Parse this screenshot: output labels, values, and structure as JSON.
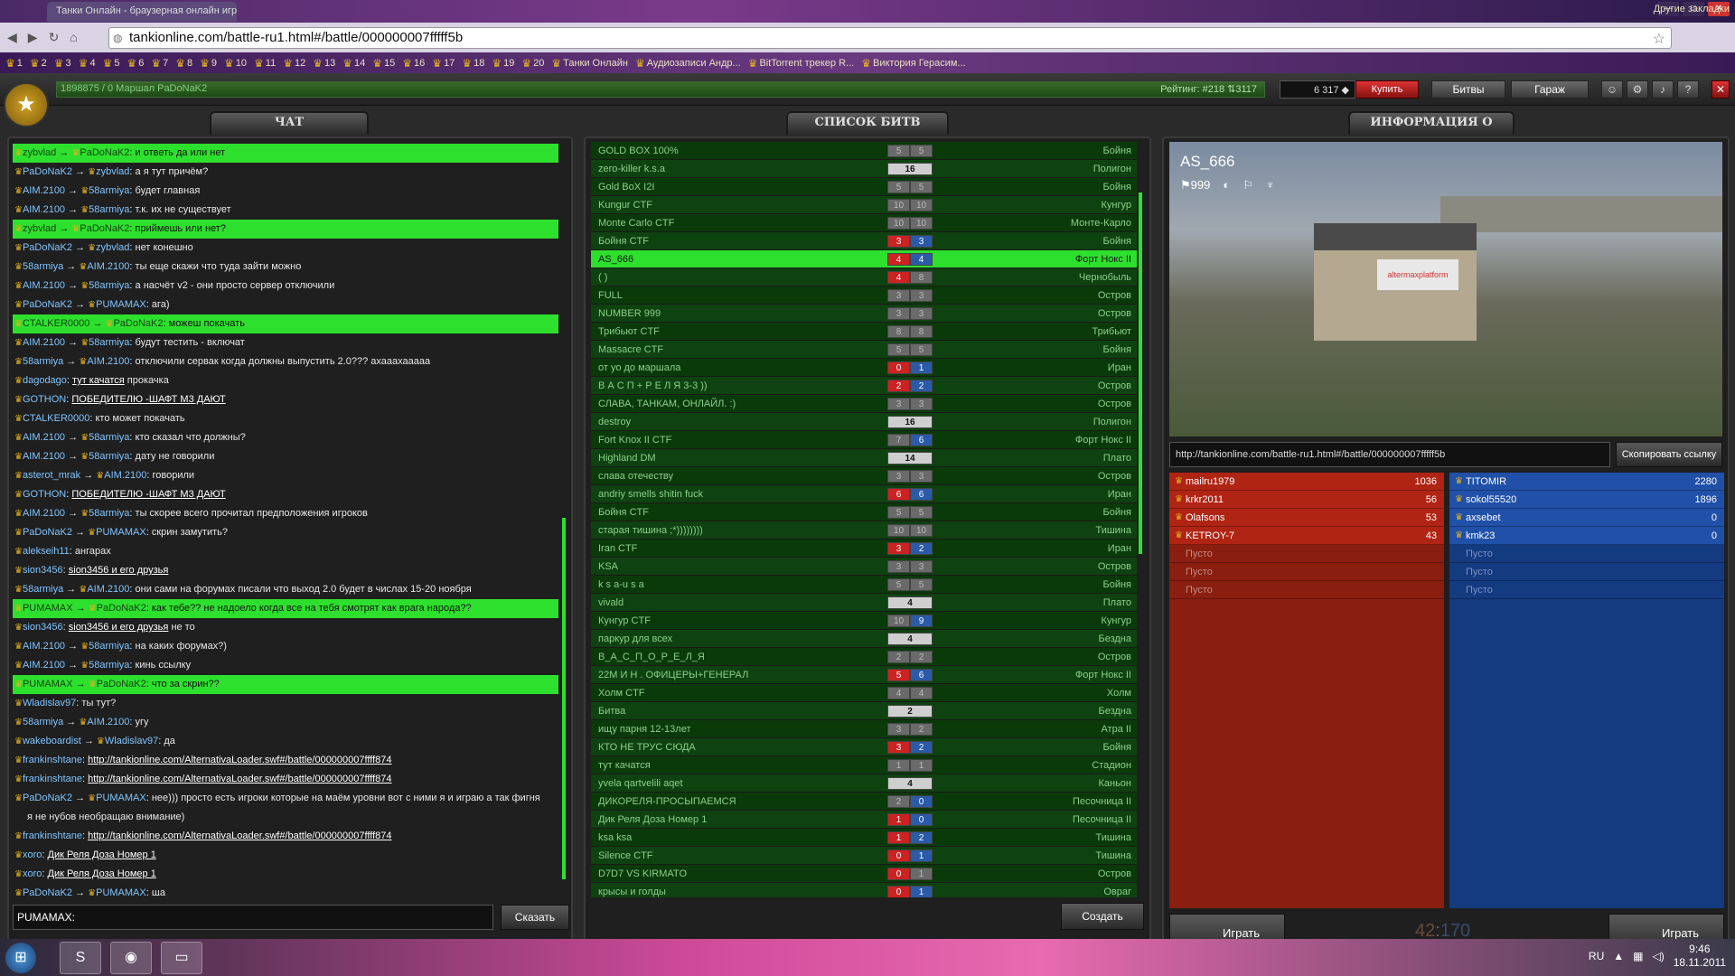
{
  "browser": {
    "tab_title": "Танки Онлайн - браузерная онлайн игра",
    "url": "tankionline.com/battle-ru1.html#/battle/000000007fffff5b",
    "bookmarks": [
      "1",
      "2",
      "3",
      "4",
      "5",
      "6",
      "7",
      "8",
      "9",
      "10",
      "11",
      "12",
      "13",
      "14",
      "15",
      "16",
      "17",
      "18",
      "19",
      "20",
      "Танки Онлайн",
      "Аудиозаписи Андр...",
      "BitTorrent трекер R...",
      "Виктория Герасим..."
    ],
    "other_bookmarks": "Другие закладки"
  },
  "topbar": {
    "xp_text": "1898875 / 0  Маршал PaDoNaK2",
    "rating": "Рейтинг: #218  ⇅3117",
    "crystals": "6 317 ◆",
    "buy_label": "Купить",
    "battles_label": "Битвы",
    "garage_label": "Гараж",
    "help_label": "?",
    "exit_label": "✕"
  },
  "titles": {
    "chat": "ЧАТ",
    "battles": "СПИСОК БИТВ",
    "info": "ИНФОРМАЦИЯ О БИТВЕ"
  },
  "chat": {
    "messages": [
      {
        "from": "zybvlad",
        "to": "PaDoNaK2",
        "text": "и ответь да или нет",
        "hl": true
      },
      {
        "from": "PaDoNaK2",
        "to": "zybvlad",
        "text": "а я тут причём?"
      },
      {
        "from": "AIM.2100",
        "to": "58armiya",
        "text": "будет главная"
      },
      {
        "from": "AIM.2100",
        "to": "58armiya",
        "text": "т.к. их не существует"
      },
      {
        "from": "zybvlad",
        "to": "PaDoNaK2",
        "text": "приймешь или нет?",
        "hl": true
      },
      {
        "from": "PaDoNaK2",
        "to": "zybvlad",
        "text": "нет конешно"
      },
      {
        "from": "58armiya",
        "to": "AIM.2100",
        "text": "ты еще скажи что туда зайти можно"
      },
      {
        "from": "AIM.2100",
        "to": "58armiya",
        "text": "а насчёт v2 - они просто сервер отключили"
      },
      {
        "from": "PaDoNaK2",
        "to": "PUMAMAX",
        "text": "ага)"
      },
      {
        "from": "CTALKER0000",
        "to": "PaDoNaK2",
        "text": "можеш покачать",
        "hl": true
      },
      {
        "from": "AIM.2100",
        "to": "58armiya",
        "text": "будут тестить - включат"
      },
      {
        "from": "58armiya",
        "to": "AIM.2100",
        "text": "отключили сервак когда должны выпустить 2.0??? ахааахааааа"
      },
      {
        "from": "dagodago",
        "to": "",
        "link": "тут качатся",
        "text": "прокачка"
      },
      {
        "from": "GOTHON",
        "to": "",
        "link": "ПОБЕДИТЕЛЮ -ШАФТ М3 ДАЮТ",
        "text": ""
      },
      {
        "from": "CTALKER0000",
        "to": "",
        "text": "кто может покачать"
      },
      {
        "from": "AIM.2100",
        "to": "58armiya",
        "text": "кто сказал что должны?"
      },
      {
        "from": "AIM.2100",
        "to": "58armiya",
        "text": "дату не говорили"
      },
      {
        "from": "asterot_mrak",
        "to": "AIM.2100",
        "text": "говорили"
      },
      {
        "from": "GOTHON",
        "to": "",
        "link": "ПОБЕДИТЕЛЮ -ШАФТ М3 ДАЮТ",
        "text": ""
      },
      {
        "from": "AIM.2100",
        "to": "58armiya",
        "text": "ты скорее всего прочитал предположения игроков"
      },
      {
        "from": "PaDoNaK2",
        "to": "PUMAMAX",
        "text": "скрин замутить?"
      },
      {
        "from": "alekseih11",
        "to": "",
        "text": "ангарах"
      },
      {
        "from": "sion3456",
        "to": "",
        "link": "sion3456 и его друзья",
        "text": ""
      },
      {
        "from": "58armiya",
        "to": "AIM.2100",
        "text": "они сами на форумах писали что выход 2.0 будет в числах 15-20 ноября"
      },
      {
        "from": "PUMAMAX",
        "to": "PaDoNaK2",
        "text": "как тебе?? не надоело когда все на тебя смотрят как врага народа??",
        "hl": true
      },
      {
        "from": "sion3456",
        "to": "",
        "link": "sion3456 и его друзья",
        "text": "не то"
      },
      {
        "from": "AIM.2100",
        "to": "58armiya",
        "text": "на каких форумах?)"
      },
      {
        "from": "AIM.2100",
        "to": "58armiya",
        "text": "кинь ссылку"
      },
      {
        "from": "PUMAMAX",
        "to": "PaDoNaK2",
        "text": "что за скрин??",
        "hl": true
      },
      {
        "from": "Wladislav97",
        "to": "",
        "text": "ты тут?"
      },
      {
        "from": "58armiya",
        "to": "AIM.2100",
        "text": "угу"
      },
      {
        "from": "wakeboardist",
        "to": "Wladislav97",
        "text": "да"
      },
      {
        "from": "frankinshtane",
        "to": "",
        "link": "http://tankionline.com/AlternativaLoader.swf#/battle/000000007ffff874",
        "text": ""
      },
      {
        "from": "frankinshtane",
        "to": "",
        "link": "http://tankionline.com/AlternativaLoader.swf#/battle/000000007ffff874",
        "text": ""
      },
      {
        "from": "PaDoNaK2",
        "to": "PUMAMAX",
        "text": "нее))) просто есть игроки которые на маём уровни вот с ними я и играю а так фигня"
      },
      {
        "from": "",
        "to": "",
        "text": "я не нубов необращаю внимание)"
      },
      {
        "from": "frankinshtane",
        "to": "",
        "link": "http://tankionline.com/AlternativaLoader.swf#/battle/000000007ffff874",
        "text": ""
      },
      {
        "from": "xoro",
        "to": "",
        "link": "Дик Реля Доза Номер 1",
        "text": ""
      },
      {
        "from": "xoro",
        "to": "",
        "link": "Дик Реля Доза Номер 1",
        "text": ""
      },
      {
        "from": "PaDoNaK2",
        "to": "PUMAMAX",
        "text": "ща"
      }
    ],
    "input_value": "PUMAMAX:",
    "say_label": "Сказать"
  },
  "battles": {
    "rows": [
      {
        "name": "GOLD BOX 100%",
        "s": [
          "5",
          "5"
        ],
        "st": "g",
        "map": "Бойня"
      },
      {
        "name": "zero-killer  k.s.a",
        "s": [
          "16"
        ],
        "st": "gw",
        "map": "Полигон"
      },
      {
        "name": "Gold BoX  I2I",
        "s": [
          "5",
          "5"
        ],
        "st": "g",
        "map": "Бойня"
      },
      {
        "name": "Kungur CTF",
        "s": [
          "10",
          "10"
        ],
        "st": "g",
        "map": "Кунгур"
      },
      {
        "name": "Monte Carlo CTF",
        "s": [
          "10",
          "10"
        ],
        "st": "g",
        "map": "Монте-Карло"
      },
      {
        "name": "Бойня CTF",
        "s": [
          "3",
          "3"
        ],
        "st": "rb",
        "map": "Бойня"
      },
      {
        "name": "AS_666",
        "s": [
          "4",
          "4"
        ],
        "st": "rb",
        "map": "Форт Нокс II",
        "sel": true
      },
      {
        "name": "(                    )",
        "s": [
          "4",
          "8"
        ],
        "st": "rg",
        "map": "Чернобыль"
      },
      {
        "name": "FULL",
        "s": [
          "3",
          "3"
        ],
        "st": "g",
        "map": "Остров"
      },
      {
        "name": "NUMBER 999",
        "s": [
          "3",
          "3"
        ],
        "st": "g",
        "map": "Остров"
      },
      {
        "name": "Трибьют CTF",
        "s": [
          "8",
          "8"
        ],
        "st": "g",
        "map": "Трибьют"
      },
      {
        "name": "Massacre CTF",
        "s": [
          "5",
          "5"
        ],
        "st": "g",
        "map": "Бойня"
      },
      {
        "name": "от уо до маршала",
        "s": [
          "0",
          "1"
        ],
        "st": "rb",
        "map": "Иран"
      },
      {
        "name": "В А С П + Р Е Л Я 3-3  ))",
        "s": [
          "2",
          "2"
        ],
        "st": "rb",
        "map": "Остров"
      },
      {
        "name": "СЛАВА, ТАНКАМ, ОНЛАЙЛ. :)",
        "s": [
          "3",
          "3"
        ],
        "st": "g",
        "map": "Остров"
      },
      {
        "name": "destroy",
        "s": [
          "16"
        ],
        "st": "gw",
        "map": "Полигон"
      },
      {
        "name": "Fort Knox II CTF",
        "s": [
          "7",
          "6"
        ],
        "st": "gb",
        "map": "Форт Нокс II"
      },
      {
        "name": "Highland DM",
        "s": [
          "14"
        ],
        "st": "gw",
        "map": "Плато"
      },
      {
        "name": "слава отечеству",
        "s": [
          "3",
          "3"
        ],
        "st": "g",
        "map": "Остров"
      },
      {
        "name": "andriy smells shitin fuck",
        "s": [
          "6",
          "6"
        ],
        "st": "rb",
        "map": "Иран"
      },
      {
        "name": "Бойня CTF",
        "s": [
          "5",
          "5"
        ],
        "st": "g",
        "map": "Бойня"
      },
      {
        "name": "старая тишина ;*))))))))",
        "s": [
          "10",
          "10"
        ],
        "st": "g",
        "map": "Тишина"
      },
      {
        "name": "Iran CTF",
        "s": [
          "3",
          "2"
        ],
        "st": "rb",
        "map": "Иран"
      },
      {
        "name": "KSA",
        "s": [
          "3",
          "3"
        ],
        "st": "g",
        "map": "Остров"
      },
      {
        "name": "k s a-u s a",
        "s": [
          "5",
          "5"
        ],
        "st": "g",
        "map": "Бойня"
      },
      {
        "name": "vivald",
        "s": [
          "4"
        ],
        "st": "w",
        "map": "Плато"
      },
      {
        "name": "Кунгур CTF",
        "s": [
          "10",
          "9"
        ],
        "st": "gb",
        "map": "Кунгур"
      },
      {
        "name": "паркур для всех",
        "s": [
          "4"
        ],
        "st": "w",
        "map": "Бездна"
      },
      {
        "name": "В_А_С_П_О_Р_Е_Л_Я",
        "s": [
          "2",
          "2"
        ],
        "st": "g",
        "map": "Остров"
      },
      {
        "name": "22М И Н . ОФИЦЕРЫ+ГЕНЕРАЛ",
        "s": [
          "5",
          "6"
        ],
        "st": "rb",
        "map": "Форт Нокс II"
      },
      {
        "name": "Холм CTF",
        "s": [
          "4",
          "4"
        ],
        "st": "g",
        "map": "Холм"
      },
      {
        "name": "Битва",
        "s": [
          "2"
        ],
        "st": "w",
        "map": "Бездна"
      },
      {
        "name": "ищу парня 12-13лет",
        "s": [
          "3",
          "2"
        ],
        "st": "g",
        "map": "Атра II"
      },
      {
        "name": "КТО НЕ ТРУС СЮДА",
        "s": [
          "3",
          "2"
        ],
        "st": "rb",
        "map": "Бойня"
      },
      {
        "name": "тут качатся",
        "s": [
          "1",
          "1"
        ],
        "st": "g",
        "map": "Стадион"
      },
      {
        "name": "yvela qartvelili aqet",
        "s": [
          "4"
        ],
        "st": "w",
        "map": "Каньон"
      },
      {
        "name": "ДИКОРЕЛЯ-ПРОСЫПАЕМСЯ",
        "s": [
          "2",
          "0"
        ],
        "st": "gb",
        "map": "Песочница II"
      },
      {
        "name": "Дик Реля Доза Номер 1",
        "s": [
          "1",
          "0"
        ],
        "st": "rb",
        "map": "Песочница II"
      },
      {
        "name": "ksa       ksa",
        "s": [
          "1",
          "2"
        ],
        "st": "rb",
        "map": "Тишина"
      },
      {
        "name": "Silence CTF",
        "s": [
          "0",
          "1"
        ],
        "st": "rb",
        "map": "Тишина"
      },
      {
        "name": "D7D7 VS KIRMATO",
        "s": [
          "0",
          "1"
        ],
        "st": "rg",
        "map": "Остров"
      },
      {
        "name": "крысы и голды",
        "s": [
          "0",
          "1"
        ],
        "st": "rb",
        "map": "Овраг"
      }
    ],
    "create_label": "Создать"
  },
  "info": {
    "battle_name": "AS_666",
    "flag_limit": "999",
    "poster": "altermaxplatform",
    "link": "http://tankionline.com/battle-ru1.html#/battle/000000007fffff5b",
    "copy_label": "Скопировать ссылку",
    "red_team": [
      {
        "name": "mailru1979",
        "score": "1036"
      },
      {
        "name": "krkr2011",
        "score": "56"
      },
      {
        "name": "Olafsons",
        "score": "53"
      },
      {
        "name": "KETROY-7",
        "score": "43"
      },
      {
        "name": "Пусто",
        "score": ""
      },
      {
        "name": "Пусто",
        "score": ""
      },
      {
        "name": "Пусто",
        "score": ""
      }
    ],
    "blue_team": [
      {
        "name": "TITOMIR",
        "score": "2280"
      },
      {
        "name": "sokol55520",
        "score": "1896"
      },
      {
        "name": "axsebet",
        "score": "0"
      },
      {
        "name": "kmk23",
        "score": "0"
      },
      {
        "name": "Пусто",
        "score": ""
      },
      {
        "name": "Пусто",
        "score": ""
      },
      {
        "name": "Пусто",
        "score": ""
      }
    ],
    "play_label": "Играть",
    "score_red": "42",
    "score_sep": ":",
    "score_blue": "170"
  },
  "taskbar": {
    "lang": "RU",
    "time": "9:46",
    "date": "18.11.2011"
  },
  "colors": {
    "highlight_green": "#2ee02e",
    "red_team": "#8a1e10",
    "blue_team": "#143a80",
    "crown": "#e0b020"
  }
}
